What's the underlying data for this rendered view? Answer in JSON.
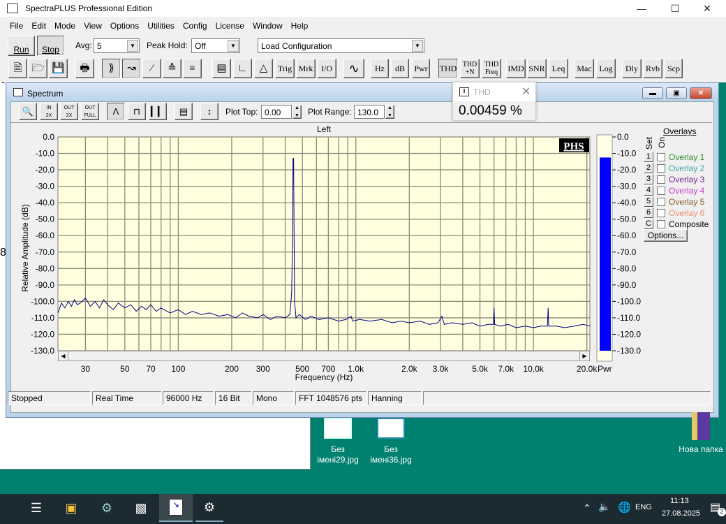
{
  "app": {
    "title": "SpectraPLUS Professional Edition",
    "menu": [
      "File",
      "Edit",
      "Mode",
      "View",
      "Options",
      "Utilities",
      "Config",
      "License",
      "Window",
      "Help"
    ],
    "run_label": "Run",
    "stop_label": "Stop",
    "avg_label": "Avg:",
    "avg_value": "5",
    "peak_hold_label": "Peak Hold:",
    "peak_hold_value": "Off",
    "config_value": "Load Configuration",
    "toolbar_text_buttons": [
      "Trig",
      "Mrk",
      "I/O",
      "Hz",
      "dB",
      "Pwr",
      "THD",
      "THD +N",
      "THD Freq",
      "IMD",
      "SNR",
      "Leq",
      "Mac",
      "Log",
      "Dly",
      "Rvb",
      "Scp"
    ]
  },
  "background_window": {
    "glyph_top": "0",
    "glyph_mid": "8"
  },
  "thd_popup": {
    "title": "THD",
    "value": "0.00459 %"
  },
  "spectrum": {
    "title": "Spectrum",
    "plot_top_label": "Plot Top:",
    "plot_top_value": "0.00",
    "plot_range_label": "Plot Range:",
    "plot_range_value": "130.0",
    "options_label": "Options...",
    "logo": "PHS",
    "pwr_label": "Pwr",
    "overlays_title": "Overlays",
    "set_label": "Set",
    "on_label": "On",
    "overlays": [
      {
        "num": "1",
        "label": "Overlay 1",
        "color": "#2f8f2f"
      },
      {
        "num": "2",
        "label": "Overlay 2",
        "color": "#35a8b0"
      },
      {
        "num": "3",
        "label": "Overlay 3",
        "color": "#7a1f8f"
      },
      {
        "num": "4",
        "label": "Overlay 4",
        "color": "#c83cc8"
      },
      {
        "num": "5",
        "label": "Overlay 5",
        "color": "#8a5a2a"
      },
      {
        "num": "6",
        "label": "Overlay 6",
        "color": "#e8916a"
      },
      {
        "num": "C",
        "label": "Composite",
        "color": "#000000"
      }
    ]
  },
  "status": [
    "Stopped",
    "Real Time",
    "96000 Hz",
    "16 Bit",
    "Mono",
    "FFT 1048576 pts",
    "Hanning"
  ],
  "desktop": {
    "icons": [
      {
        "label1": "Без",
        "label2": "імені29.jpg"
      },
      {
        "label1": "Без",
        "label2": "імені36.jpg"
      },
      {
        "label1": "Нова папка",
        "label2": ""
      }
    ]
  },
  "taskbar": {
    "lang": "ENG",
    "time": "11:13",
    "date": "27.08.2025",
    "notif_count": "2"
  },
  "chart_data": {
    "type": "line",
    "title": "Left",
    "xlabel": "Frequency (Hz)",
    "ylabel": "Relative Amplitude (dB)",
    "xscale": "log",
    "xlim": [
      21,
      20800
    ],
    "ylim": [
      -130,
      0
    ],
    "grid": true,
    "x_ticks": [
      {
        "v": 30,
        "l": "30"
      },
      {
        "v": 50,
        "l": "50"
      },
      {
        "v": 70,
        "l": "70"
      },
      {
        "v": 100,
        "l": "100"
      },
      {
        "v": 200,
        "l": "200"
      },
      {
        "v": 300,
        "l": "300"
      },
      {
        "v": 500,
        "l": "500"
      },
      {
        "v": 700,
        "l": "700"
      },
      {
        "v": 1000,
        "l": "1.0k"
      },
      {
        "v": 2000,
        "l": "2.0k"
      },
      {
        "v": 3000,
        "l": "3.0k"
      },
      {
        "v": 5000,
        "l": "5.0k"
      },
      {
        "v": 7000,
        "l": "7.0k"
      },
      {
        "v": 10000,
        "l": "10.0k"
      },
      {
        "v": 20000,
        "l": "20.0k"
      }
    ],
    "y_ticks": [
      "0.0",
      "-10.0",
      "-20.0",
      "-30.0",
      "-40.0",
      "-50.0",
      "-60.0",
      "-70.0",
      "-80.0",
      "-90.0",
      "-100.0",
      "-110.0",
      "-120.0",
      "-130.0"
    ],
    "line_color": "#000080",
    "plot_bg": "#ffffe0",
    "series": [
      {
        "points": [
          [
            21,
            -107
          ],
          [
            22,
            -101
          ],
          [
            23,
            -104
          ],
          [
            24,
            -100
          ],
          [
            25,
            -103
          ],
          [
            26,
            -99
          ],
          [
            27,
            -102
          ],
          [
            28,
            -101
          ],
          [
            30,
            -98
          ],
          [
            32,
            -103
          ],
          [
            34,
            -100
          ],
          [
            36,
            -104
          ],
          [
            38,
            -99
          ],
          [
            40,
            -102
          ],
          [
            43,
            -105
          ],
          [
            46,
            -101
          ],
          [
            50,
            -104
          ],
          [
            54,
            -102
          ],
          [
            58,
            -106
          ],
          [
            62,
            -103
          ],
          [
            66,
            -105
          ],
          [
            70,
            -102
          ],
          [
            75,
            -106
          ],
          [
            80,
            -104
          ],
          [
            90,
            -107
          ],
          [
            100,
            -105
          ],
          [
            110,
            -108
          ],
          [
            120,
            -106
          ],
          [
            135,
            -108
          ],
          [
            150,
            -107
          ],
          [
            170,
            -109
          ],
          [
            190,
            -108
          ],
          [
            210,
            -110
          ],
          [
            230,
            -107
          ],
          [
            250,
            -109
          ],
          [
            280,
            -110
          ],
          [
            300,
            -108
          ],
          [
            330,
            -111
          ],
          [
            360,
            -109
          ],
          [
            400,
            -110
          ],
          [
            425,
            -108
          ],
          [
            435,
            -95
          ],
          [
            440,
            -60
          ],
          [
            443,
            -13
          ],
          [
            446,
            -13
          ],
          [
            449,
            -60
          ],
          [
            452,
            -100
          ],
          [
            460,
            -110
          ],
          [
            480,
            -108
          ],
          [
            520,
            -111
          ],
          [
            560,
            -109
          ],
          [
            620,
            -111
          ],
          [
            700,
            -110
          ],
          [
            800,
            -112
          ],
          [
            880,
            -111
          ],
          [
            940,
            -109
          ],
          [
            960,
            -112
          ],
          [
            1050,
            -111
          ],
          [
            1200,
            -112
          ],
          [
            1400,
            -111
          ],
          [
            1600,
            -113
          ],
          [
            1800,
            -112
          ],
          [
            2000,
            -113
          ],
          [
            2300,
            -112
          ],
          [
            2600,
            -114
          ],
          [
            2900,
            -113
          ],
          [
            3050,
            -109
          ],
          [
            3150,
            -114
          ],
          [
            3500,
            -113
          ],
          [
            4000,
            -114
          ],
          [
            4500,
            -113
          ],
          [
            5000,
            -115
          ],
          [
            5600,
            -114
          ],
          [
            5950,
            -114
          ],
          [
            6000,
            -104
          ],
          [
            6050,
            -114
          ],
          [
            6500,
            -115
          ],
          [
            7200,
            -114
          ],
          [
            8000,
            -116
          ],
          [
            9000,
            -115
          ],
          [
            10000,
            -116
          ],
          [
            11000,
            -115
          ],
          [
            12000,
            -115
          ],
          [
            12100,
            -104
          ],
          [
            12200,
            -115
          ],
          [
            13500,
            -115
          ],
          [
            15000,
            -116
          ],
          [
            17000,
            -115
          ],
          [
            19000,
            -114
          ],
          [
            20800,
            -115
          ]
        ]
      }
    ],
    "power_meter": {
      "level_db": -12.5,
      "ylim": [
        -130,
        0
      ],
      "color": "#0000ff"
    }
  }
}
